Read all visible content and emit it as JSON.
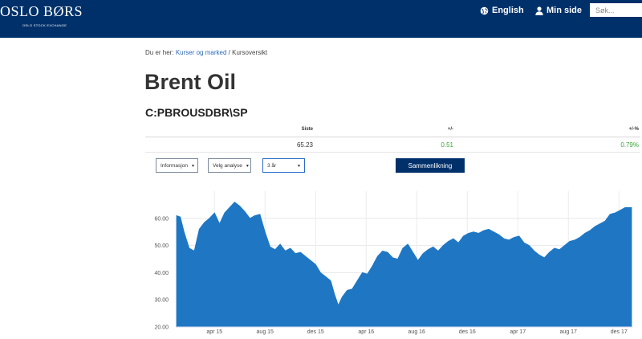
{
  "header": {
    "logo_text": "OSLO BØRS",
    "logo_subtext": "OSLO STOCK EXCHANGE",
    "english_label": "English",
    "mypage_label": "Min side",
    "search_placeholder": "Søk...",
    "colors": {
      "background": "#00306a",
      "text": "#ffffff"
    }
  },
  "breadcrumb": {
    "prefix": "Du er her:",
    "link": "Kurser og marked",
    "separator": "/",
    "current": "Kursoversikt"
  },
  "title": "Brent Oil",
  "ticker": "C:PBROUSDBR\\SP",
  "quote": {
    "headers": [
      "Siste",
      "+/-",
      "+/-%"
    ],
    "values": [
      "65.23",
      "0.51",
      "0.79%"
    ],
    "change_color": "#3ba53b"
  },
  "controls": {
    "info_label": "Informasjon",
    "analysis_label": "Velg analyse",
    "period_label": "3 år",
    "compare_label": "Sammenlikning"
  },
  "chart_data": {
    "type": "area",
    "y_ticks": [
      "60.00",
      "50.00",
      "40.00",
      "30.00",
      "20.00"
    ],
    "ylim": [
      20,
      70
    ],
    "x_ticks": [
      "apr 15",
      "aug 15",
      "des 15",
      "apr 16",
      "aug 16",
      "des 16",
      "apr 17",
      "aug 17",
      "des 17"
    ],
    "x_tick_positions": [
      3,
      7,
      11,
      15,
      19,
      23,
      27,
      31,
      35
    ],
    "xlim": [
      0,
      36
    ],
    "x_unit": "months since jan 15",
    "fill_color": "#1f77c4",
    "grid": true,
    "series": [
      {
        "x": [
          0,
          0.3,
          0.6,
          1.0,
          1.4,
          1.8,
          2.2,
          2.6,
          3.0,
          3.4,
          3.8,
          4.2,
          4.6,
          5.0,
          5.4,
          5.8,
          6.2,
          6.6,
          7.0,
          7.4,
          7.8,
          8.2,
          8.6,
          9.0,
          9.4,
          9.8,
          10.2,
          10.6,
          11.0,
          11.4,
          11.8,
          12.2,
          12.5,
          12.8,
          13.1,
          13.5,
          13.9,
          14.3,
          14.7,
          15.1,
          15.5,
          15.9,
          16.3,
          16.7,
          17.1,
          17.5,
          17.9,
          18.3,
          18.7,
          19.1,
          19.5,
          19.9,
          20.3,
          20.7,
          21.1,
          21.5,
          21.9,
          22.3,
          22.7,
          23.1,
          23.5,
          23.9,
          24.3,
          24.7,
          25.1,
          25.5,
          25.9,
          26.3,
          26.7,
          27.1,
          27.5,
          27.9,
          28.3,
          28.7,
          29.1,
          29.5,
          29.9,
          30.3,
          30.7,
          31.1,
          31.5,
          31.9,
          32.3,
          32.7,
          33.1,
          33.5,
          33.9,
          34.3,
          34.7,
          35.1,
          35.5,
          36.0
        ],
        "y": [
          61.0,
          60.5,
          55.0,
          49.0,
          48.0,
          56.0,
          58.5,
          60.0,
          62.0,
          58.0,
          62.0,
          64.0,
          66.0,
          64.5,
          62.5,
          60.0,
          61.0,
          61.5,
          55.0,
          49.5,
          48.5,
          50.5,
          48.0,
          49.0,
          47.0,
          47.5,
          46.0,
          44.5,
          43.0,
          40.0,
          38.5,
          37.0,
          32.0,
          28.0,
          31.0,
          33.5,
          34.0,
          37.0,
          40.0,
          39.5,
          42.5,
          46.0,
          48.0,
          47.5,
          45.5,
          45.0,
          49.0,
          50.5,
          47.5,
          44.5,
          47.0,
          48.5,
          49.5,
          48.0,
          50.0,
          51.5,
          52.5,
          51.0,
          53.5,
          54.5,
          55.0,
          54.5,
          55.5,
          56.0,
          55.0,
          54.0,
          52.5,
          52.0,
          53.0,
          53.5,
          51.0,
          50.0,
          48.0,
          46.5,
          45.5,
          47.5,
          49.0,
          48.5,
          50.0,
          51.5,
          52.0,
          53.0,
          54.5,
          55.5,
          57.0,
          58.0,
          59.0,
          61.5,
          62.0,
          63.0,
          64.0,
          64.0
        ]
      }
    ]
  }
}
